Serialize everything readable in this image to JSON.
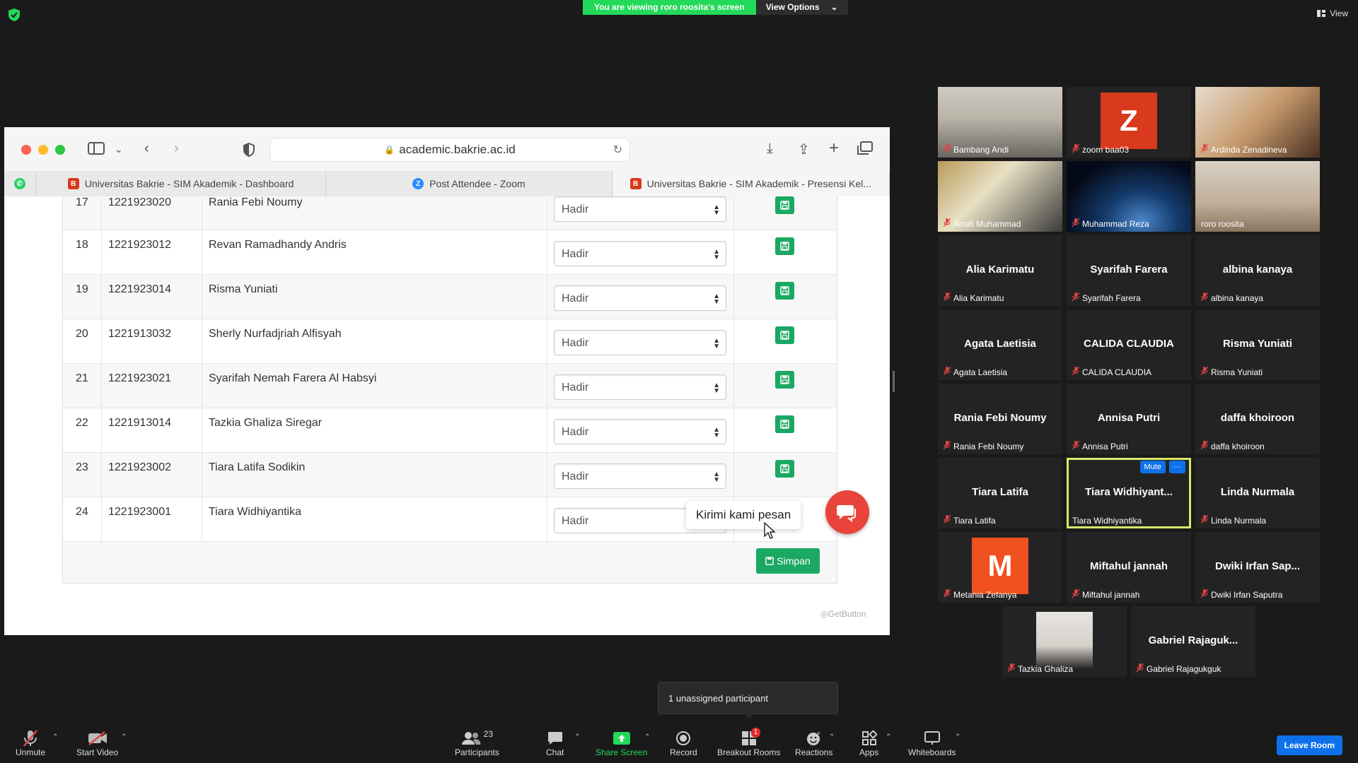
{
  "zoom": {
    "banner_text": "You are viewing roro roosita's screen",
    "view_options": "View Options",
    "view_label": "View",
    "unassigned_popup": "1 unassigned participant",
    "leave_label": "Leave Room",
    "controls": {
      "unmute": "Unmute",
      "start_video": "Start Video",
      "participants": "Participants",
      "participants_count": "23",
      "chat": "Chat",
      "share_screen": "Share Screen",
      "record": "Record",
      "breakout_rooms": "Breakout Rooms",
      "breakout_badge": "1",
      "reactions": "Reactions",
      "apps": "Apps",
      "whiteboards": "Whiteboards"
    },
    "participants": [
      {
        "name": "Bambang Andi",
        "display": "",
        "kind": "photo"
      },
      {
        "name": "zoom baa03",
        "display": "Z",
        "kind": "avatar",
        "color": "#d9391c"
      },
      {
        "name": "Ardinda Zenadineva",
        "display": "",
        "kind": "photo"
      },
      {
        "name": "Arrafi Muhammad",
        "display": "",
        "kind": "photo"
      },
      {
        "name": "Muhammad Reza",
        "display": "",
        "kind": "photo"
      },
      {
        "name": "roro roosita",
        "display": "",
        "kind": "photo"
      },
      {
        "name": "Alia Karimatu",
        "display": "Alia Karimatu",
        "kind": "text"
      },
      {
        "name": "Syarifah Farera",
        "display": "Syarifah Farera",
        "kind": "text"
      },
      {
        "name": "albina kanaya",
        "display": "albina kanaya",
        "kind": "text"
      },
      {
        "name": "Agata Laetisia",
        "display": "Agata Laetisia",
        "kind": "text"
      },
      {
        "name": "CALIDA CLAUDIA",
        "display": "CALIDA CLAUDIA",
        "kind": "text"
      },
      {
        "name": "Risma Yuniati",
        "display": "Risma Yuniati",
        "kind": "text"
      },
      {
        "name": "Rania Febi Noumy",
        "display": "Rania Febi Noumy",
        "kind": "text"
      },
      {
        "name": "Annisa Putri",
        "display": "Annisa Putri",
        "kind": "text"
      },
      {
        "name": "daffa khoiroon",
        "display": "daffa khoiroon",
        "kind": "text"
      },
      {
        "name": "Tiara Latifa",
        "display": "Tiara Latifa",
        "kind": "text"
      },
      {
        "name": "Tiara Widhiyantika",
        "display": "Tiara  Widhiyant...",
        "kind": "text",
        "highlight": true,
        "mute_label": "Mute",
        "more_label": "···"
      },
      {
        "name": "Linda Nurmala",
        "display": "Linda Nurmala",
        "kind": "text"
      },
      {
        "name": "Metania Zefanya",
        "display": "M",
        "kind": "avatar",
        "color": "#f0511f"
      },
      {
        "name": "Miftahul jannah",
        "display": "Miftahul jannah",
        "kind": "text"
      },
      {
        "name": "Dwiki Irfan Saputra",
        "display": "Dwiki  Irfan  Sap...",
        "kind": "text"
      },
      {
        "name": "Tazkia Ghaliza",
        "display": "",
        "kind": "photo"
      },
      {
        "name": "Gabriel Rajagukguk",
        "display": "Gabriel  Rajaguk...",
        "kind": "text"
      }
    ]
  },
  "browser": {
    "url": "academic.bakrie.ac.id",
    "tabs": [
      {
        "label": "Universitas Bakrie - SIM Akademik - Dashboard"
      },
      {
        "label": "Post Attendee - Zoom"
      },
      {
        "label": "Universitas Bakrie - SIM Akademik - Presensi Kel..."
      }
    ],
    "rows": [
      {
        "no": "17",
        "nim": "1221923020",
        "name": "Rania Febi Noumy",
        "status": "Hadir"
      },
      {
        "no": "18",
        "nim": "1221923012",
        "name": "Revan Ramadhandy Andris",
        "status": "Hadir"
      },
      {
        "no": "19",
        "nim": "1221923014",
        "name": "Risma Yuniati",
        "status": "Hadir"
      },
      {
        "no": "20",
        "nim": "1221913032",
        "name": "Sherly Nurfadjriah Alfisyah",
        "status": "Hadir"
      },
      {
        "no": "21",
        "nim": "1221923021",
        "name": "Syarifah Nemah Farera Al Habsyi",
        "status": "Hadir"
      },
      {
        "no": "22",
        "nim": "1221913014",
        "name": "Tazkia Ghaliza Siregar",
        "status": "Hadir"
      },
      {
        "no": "23",
        "nim": "1221923002",
        "name": "Tiara Latifa Sodikin",
        "status": "Hadir"
      },
      {
        "no": "24",
        "nim": "1221923001",
        "name": "Tiara Widhiyantika",
        "status": "Hadir"
      }
    ],
    "save_all_label": "Simpan",
    "chat_prompt": "Kirimi kami pesan",
    "getbutton_label": "GetButton"
  }
}
